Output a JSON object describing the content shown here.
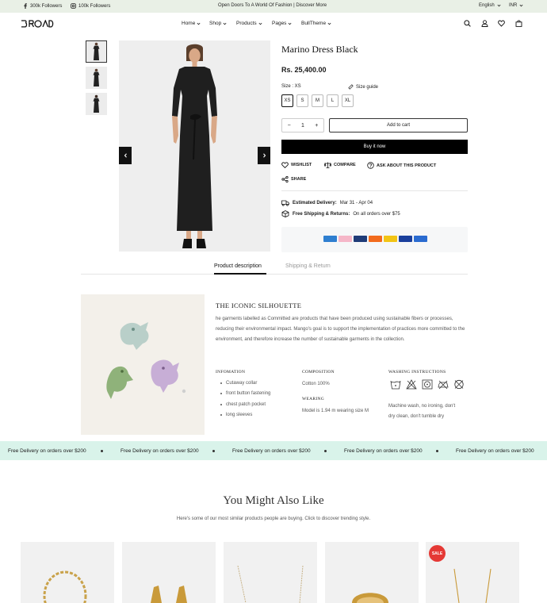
{
  "topbar": {
    "facebook": "300k Followers",
    "instagram": "100k Followers",
    "announcement": "Open Doors To A World Of Fashion | Discover More",
    "language": "English",
    "currency": "INR"
  },
  "header": {
    "logo": "BROAD",
    "nav": [
      "Home",
      "Shop",
      "Products",
      "Pages",
      "BullTheme"
    ]
  },
  "product": {
    "title": "Marino Dress Black",
    "price": "Rs. 25,400.00",
    "size_label": "Size : XS",
    "size_guide": "Size guide",
    "sizes": [
      "XS",
      "S",
      "M",
      "L",
      "XL"
    ],
    "selected_size": "XS",
    "quantity": "1",
    "add_to_cart": "Add to cart",
    "buy_now": "Buy it now",
    "actions": {
      "wishlist": "WISHLIST",
      "compare": "COMPARE",
      "ask": "ASK ABOUT THIS PRODUCT",
      "share": "SHARE"
    },
    "delivery_label": "Estimated Delivery:",
    "delivery_value": "Mar 31 - Apr 04",
    "shipping_label": "Free Shipping & Returns:",
    "shipping_value": "On all orders over $75",
    "payment_cards": [
      "Amex",
      "Klarna",
      "Discover",
      "Mastercard",
      "Bitcoin",
      "Visa",
      "PayPal"
    ]
  },
  "tabs": [
    "Product description",
    "Shipping & Return"
  ],
  "description": {
    "heading": "THE ICONIC SILHOUETTE",
    "paragraph": "he garments labelled as Committed are products that have been produced using sustainable fibers or processes, reducing their environmental impact. Mango's goal is to support the implementation of practices more committed to the environment, and therefore increase the number of sustainable garments in the collection.",
    "information_title": "INFOMATION",
    "information": [
      "Cutaway collar",
      "front button fastening",
      "chest patch pocket",
      "long sleeves"
    ],
    "composition_title": "COMPOSITION",
    "composition": "Cotton 100%",
    "wearing_title": "WEARING",
    "wearing": "Model is 1.94 m wearing size M",
    "washing_title": "WASHING INSTRUCTIONS",
    "washing_text_1": "Machine wash, no ironing, don't",
    "washing_text_2": "dry clean, don't tumble dry"
  },
  "marquee": {
    "text": "Free Delivery on orders over $200"
  },
  "related": {
    "title": "You Might Also Like",
    "subtitle": "Here's some of our most similar products people are buying. Click to discover trending style.",
    "sale_badge": "SALE"
  },
  "colors": {
    "topbar_bg": "#e9f0e6",
    "marquee_bg": "#d9f3ea",
    "sale_badge": "#e53935",
    "button_dark": "#000000"
  }
}
